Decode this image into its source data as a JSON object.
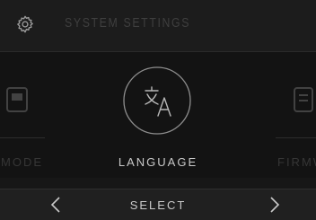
{
  "header": {
    "title": "SYSTEM SETTINGS",
    "icon": "gear-icon"
  },
  "carousel": {
    "prev_item": {
      "label": "MODE",
      "icon": "mode-icon"
    },
    "current_item": {
      "label": "LANGUAGE",
      "icon": "language-icon"
    },
    "next_item": {
      "label": "FIRMWARE",
      "icon": "firmware-icon"
    }
  },
  "bottom_bar": {
    "prev_symbol": "<",
    "select_label": "SELECT",
    "next_symbol": ">"
  },
  "colors": {
    "background": "#171717",
    "header_bg": "#1c1c1c",
    "bottom_bg": "#202020",
    "text_active": "#c9c9c9",
    "text_dim": "#3f3f3f"
  }
}
